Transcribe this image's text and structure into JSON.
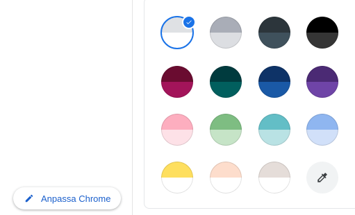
{
  "customize_button": {
    "label": "Anpassa Chrome",
    "icon": "pencil-icon",
    "color": "#1a5fcc"
  },
  "color_swatches": [
    {
      "name": "grey-default",
      "top": "#dfe1e4",
      "bottom": "#ffffff",
      "selected": true
    },
    {
      "name": "cool-grey",
      "top": "#a9adb7",
      "bottom": "#dcdee2",
      "selected": false
    },
    {
      "name": "slate",
      "top": "#2c353b",
      "bottom": "#3f515c",
      "selected": false
    },
    {
      "name": "black",
      "top": "#000000",
      "bottom": "#353535",
      "selected": false
    },
    {
      "name": "burgundy",
      "top": "#6a0c30",
      "bottom": "#a3145a",
      "selected": false
    },
    {
      "name": "dark-teal",
      "top": "#003b3e",
      "bottom": "#015f5e",
      "selected": false
    },
    {
      "name": "navy",
      "top": "#0e3367",
      "bottom": "#1a59a6",
      "selected": false
    },
    {
      "name": "purple",
      "top": "#4b2a74",
      "bottom": "#6f44a7",
      "selected": false
    },
    {
      "name": "pink",
      "top": "#fdaebf",
      "bottom": "#fde1e7",
      "selected": false
    },
    {
      "name": "green",
      "top": "#7ebd82",
      "bottom": "#c6e4c7",
      "selected": false
    },
    {
      "name": "aqua",
      "top": "#63bec6",
      "bottom": "#b9e2e4",
      "selected": false
    },
    {
      "name": "light-blue",
      "top": "#8fb6f0",
      "bottom": "#d1e0f9",
      "selected": false
    },
    {
      "name": "yellow",
      "top": "#fedf5f",
      "bottom": "#ffffff",
      "selected": false
    },
    {
      "name": "peach",
      "top": "#fdddcc",
      "bottom": "#ffffff",
      "selected": false
    },
    {
      "name": "beige",
      "top": "#e5ddd9",
      "bottom": "#ffffff",
      "selected": false
    }
  ],
  "custom_color": {
    "icon": "eyedropper-icon"
  },
  "accent_color": "#1a73e8"
}
